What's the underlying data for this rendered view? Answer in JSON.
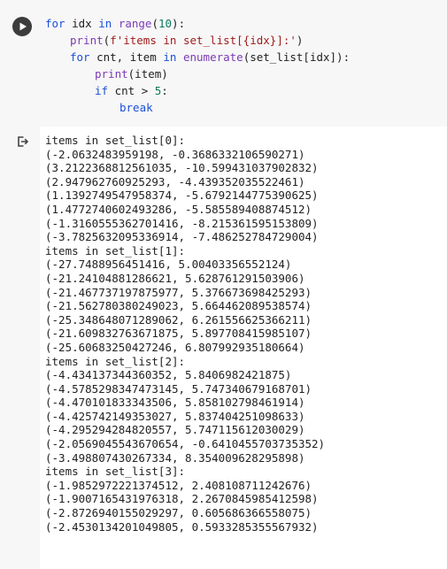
{
  "cell": {
    "code_lines": [
      {
        "indent": 0,
        "parts": [
          [
            "kw",
            "for"
          ],
          [
            "t",
            " idx "
          ],
          [
            "kw",
            "in"
          ],
          [
            "t",
            " "
          ],
          [
            "fn",
            "range"
          ],
          [
            "t",
            "("
          ],
          [
            "num",
            "10"
          ],
          [
            "t",
            "):"
          ]
        ]
      },
      {
        "indent": 1,
        "parts": [
          [
            "fn",
            "print"
          ],
          [
            "t",
            "("
          ],
          [
            "str",
            "f'items in set_list[{idx}]:'"
          ],
          [
            "t",
            ")"
          ]
        ]
      },
      {
        "indent": 1,
        "parts": [
          [
            "kw",
            "for"
          ],
          [
            "t",
            " cnt, item "
          ],
          [
            "kw",
            "in"
          ],
          [
            "t",
            " "
          ],
          [
            "fn",
            "enumerate"
          ],
          [
            "t",
            "(set_list[idx]):"
          ]
        ]
      },
      {
        "indent": 2,
        "parts": [
          [
            "fn",
            "print"
          ],
          [
            "t",
            "(item)"
          ]
        ]
      },
      {
        "indent": 2,
        "parts": [
          [
            "kw",
            "if"
          ],
          [
            "t",
            " cnt > "
          ],
          [
            "num",
            "5"
          ],
          [
            "t",
            ":"
          ]
        ]
      },
      {
        "indent": 3,
        "parts": [
          [
            "kw",
            "break"
          ]
        ]
      }
    ]
  },
  "output": {
    "lines": [
      "items in set_list[0]:",
      "(-2.0632483959198, -0.3686332106590271)",
      "(3.2122368812561035, -10.599431037902832)",
      "(2.947962760925293, -4.439352035522461)",
      "(1.1392749547958374, -5.6792144775390625)",
      "(1.4772740602493286, -5.585589408874512)",
      "(-1.3160555362701416, -8.215361595153809)",
      "(-3.7825632095336914, -7.486252784729004)",
      "items in set_list[1]:",
      "(-27.7488956451416, 5.00403356552124)",
      "(-21.24104881286621, 5.628761291503906)",
      "(-21.467737197875977, 5.376673698425293)",
      "(-21.562780380249023, 5.664462089538574)",
      "(-25.348648071289062, 6.261556625366211)",
      "(-21.609832763671875, 5.897708415985107)",
      "(-25.60683250427246, 6.807992935180664)",
      "items in set_list[2]:",
      "(-4.434137344360352, 5.8406982421875)",
      "(-4.5785298347473145, 5.747340679168701)",
      "(-4.470101833343506, 5.858102798461914)",
      "(-4.425742149353027, 5.837404251098633)",
      "(-4.295294284820557, 5.747115612030029)",
      "(-2.0569045543670654, -0.6410455703735352)",
      "(-3.498807430267334, 8.354009628295898)",
      "items in set_list[3]:",
      "(-1.9852972221374512, 2.408108711242676)",
      "(-1.9007165431976318, 2.2670845985412598)",
      "(-2.8726940155029297, 0.605686366558075)",
      "(-2.4530134201049805, 0.5933285355567932)"
    ]
  }
}
